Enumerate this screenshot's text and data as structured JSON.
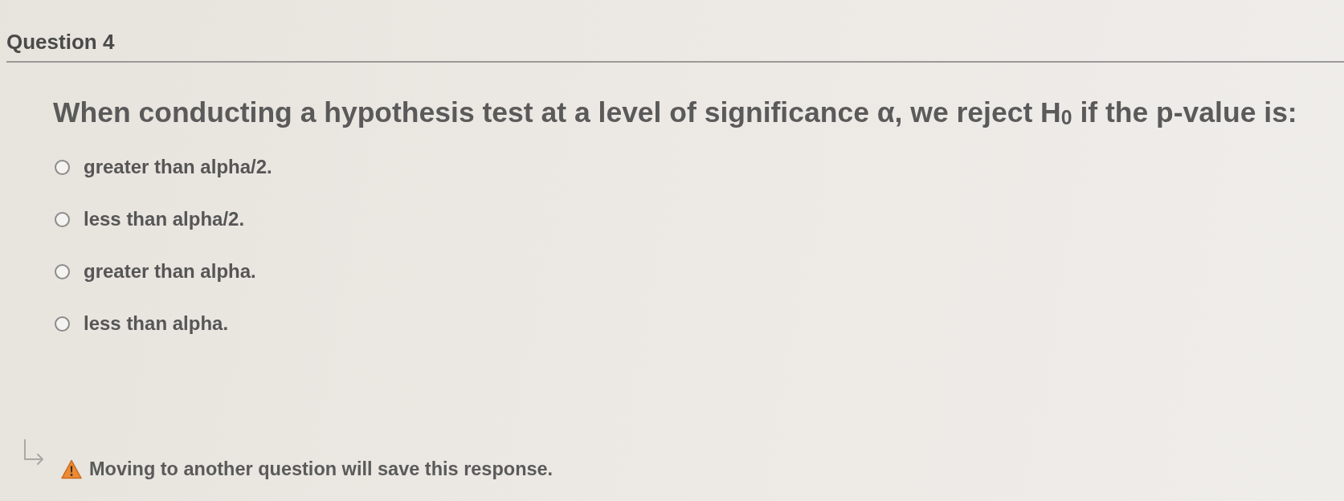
{
  "question": {
    "title": "Question 4",
    "text": "When conducting a hypothesis test at a level of significance α, we reject H$_{0}$ if the p-value is:"
  },
  "options": [
    {
      "label": "greater than alpha/2.",
      "selected": false
    },
    {
      "label": "less than alpha/2.",
      "selected": false
    },
    {
      "label": "greater than alpha.",
      "selected": false
    },
    {
      "label": "less than alpha.",
      "selected": false
    }
  ],
  "notice": {
    "text": "Moving to another question will save this response."
  }
}
